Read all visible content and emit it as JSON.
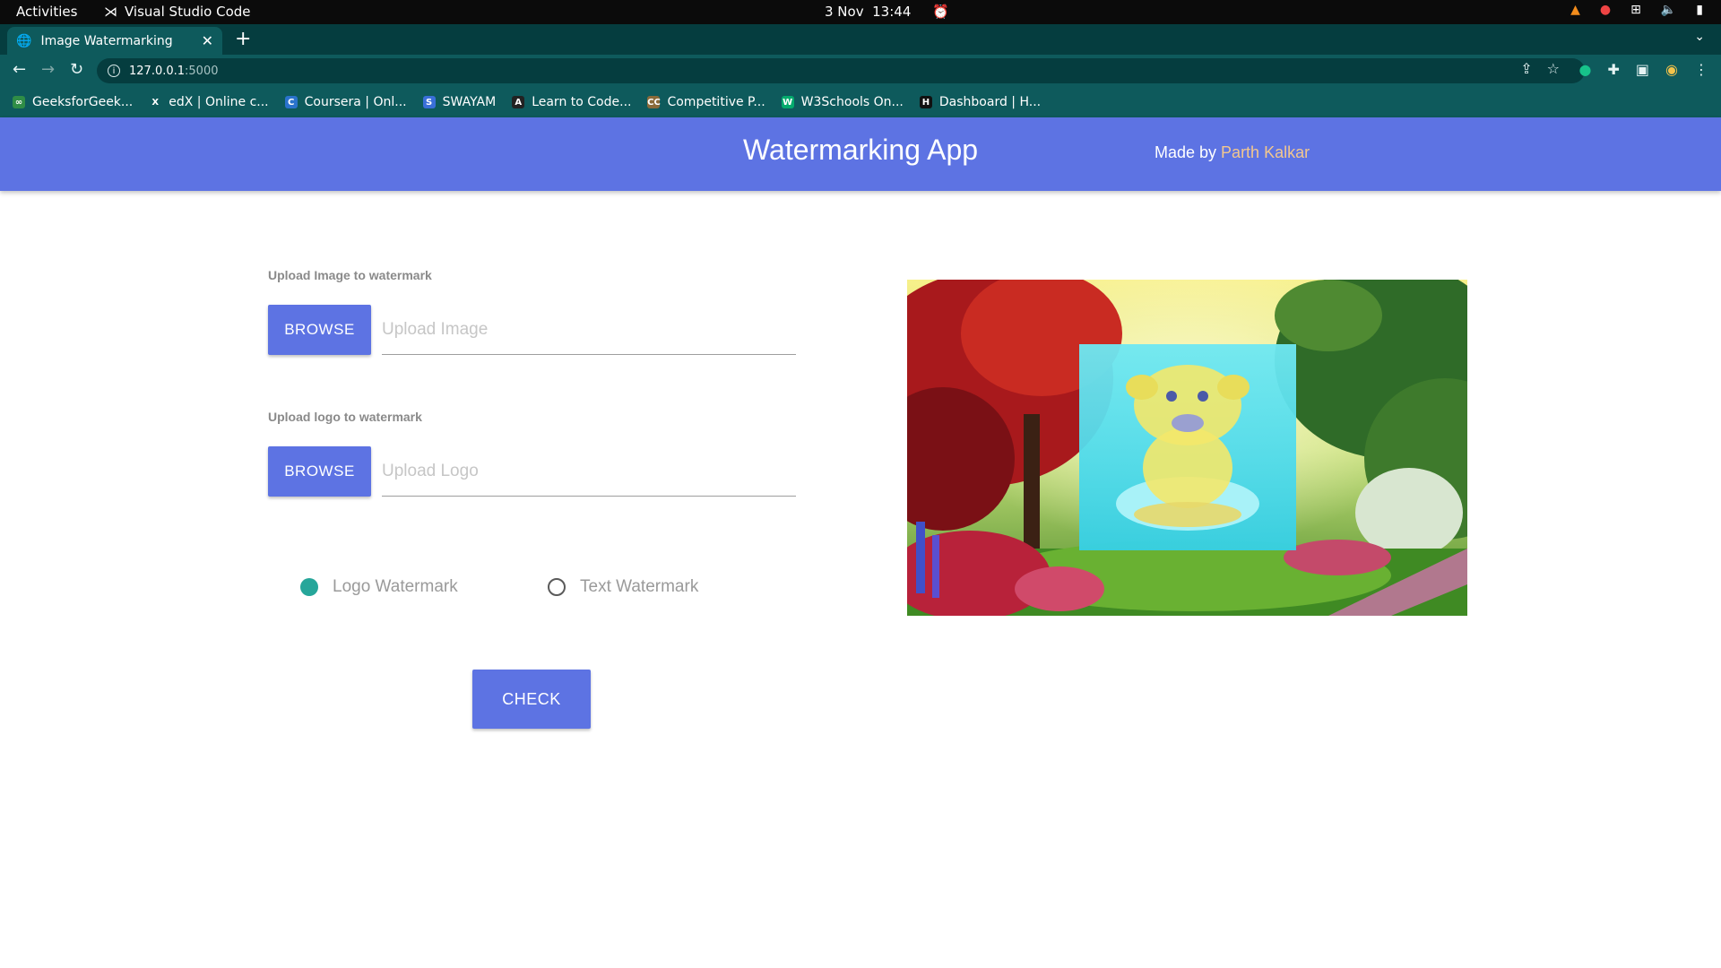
{
  "os": {
    "activities": "Activities",
    "app_name": "Visual Studio Code",
    "date": "3 Nov",
    "time": "13:44"
  },
  "browser": {
    "tab_title": "Image Watermarking",
    "url_host": "127.0.0.1",
    "url_port": ":5000",
    "bookmarks": [
      {
        "label": "GeeksforGeek...",
        "color": "#2f8d46",
        "glyph": "∞"
      },
      {
        "label": "edX | Online c...",
        "color": "#0e5a5c",
        "glyph": "X"
      },
      {
        "label": "Coursera | Onl...",
        "color": "#2a73cc",
        "glyph": "C"
      },
      {
        "label": "SWAYAM",
        "color": "#3a6fd8",
        "glyph": "S"
      },
      {
        "label": "Learn to Code...",
        "color": "#222222",
        "glyph": "A"
      },
      {
        "label": "Competitive P...",
        "color": "#8a6a3a",
        "glyph": "CC"
      },
      {
        "label": "W3Schools On...",
        "color": "#04aa6d",
        "glyph": "W"
      },
      {
        "label": "Dashboard | H...",
        "color": "#111111",
        "glyph": "H"
      }
    ]
  },
  "header": {
    "title": "Watermarking App",
    "made_by": "Made by ",
    "author": "Parth Kalkar"
  },
  "form": {
    "image_label": "Upload Image to watermark",
    "image_browse": "BROWSE",
    "image_placeholder": "Upload Image",
    "logo_label": "Upload logo to watermark",
    "logo_browse": "BROWSE",
    "logo_placeholder": "Upload Logo",
    "radio_logo": "Logo Watermark",
    "radio_text": "Text Watermark",
    "radio_selected": "logo",
    "check_label": "CHECK"
  },
  "colors": {
    "accent": "#5d73e3",
    "radio_on": "#26a69a",
    "author": "#f3c78e"
  }
}
